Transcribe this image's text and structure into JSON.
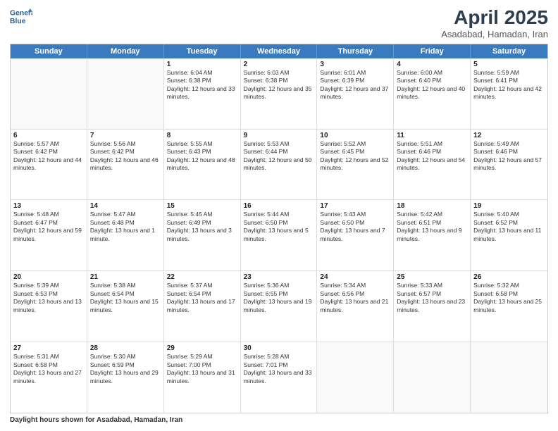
{
  "header": {
    "logo_line1": "General",
    "logo_line2": "Blue",
    "month": "April 2025",
    "location": "Asadabad, Hamadan, Iran"
  },
  "days_of_week": [
    "Sunday",
    "Monday",
    "Tuesday",
    "Wednesday",
    "Thursday",
    "Friday",
    "Saturday"
  ],
  "weeks": [
    [
      {
        "day": "",
        "empty": true
      },
      {
        "day": "",
        "empty": true
      },
      {
        "day": "1",
        "sunrise": "6:04 AM",
        "sunset": "6:38 PM",
        "daylight": "12 hours and 33 minutes."
      },
      {
        "day": "2",
        "sunrise": "6:03 AM",
        "sunset": "6:38 PM",
        "daylight": "12 hours and 35 minutes."
      },
      {
        "day": "3",
        "sunrise": "6:01 AM",
        "sunset": "6:39 PM",
        "daylight": "12 hours and 37 minutes."
      },
      {
        "day": "4",
        "sunrise": "6:00 AM",
        "sunset": "6:40 PM",
        "daylight": "12 hours and 40 minutes."
      },
      {
        "day": "5",
        "sunrise": "5:59 AM",
        "sunset": "6:41 PM",
        "daylight": "12 hours and 42 minutes."
      }
    ],
    [
      {
        "day": "6",
        "sunrise": "5:57 AM",
        "sunset": "6:42 PM",
        "daylight": "12 hours and 44 minutes."
      },
      {
        "day": "7",
        "sunrise": "5:56 AM",
        "sunset": "6:42 PM",
        "daylight": "12 hours and 46 minutes."
      },
      {
        "day": "8",
        "sunrise": "5:55 AM",
        "sunset": "6:43 PM",
        "daylight": "12 hours and 48 minutes."
      },
      {
        "day": "9",
        "sunrise": "5:53 AM",
        "sunset": "6:44 PM",
        "daylight": "12 hours and 50 minutes."
      },
      {
        "day": "10",
        "sunrise": "5:52 AM",
        "sunset": "6:45 PM",
        "daylight": "12 hours and 52 minutes."
      },
      {
        "day": "11",
        "sunrise": "5:51 AM",
        "sunset": "6:46 PM",
        "daylight": "12 hours and 54 minutes."
      },
      {
        "day": "12",
        "sunrise": "5:49 AM",
        "sunset": "6:46 PM",
        "daylight": "12 hours and 57 minutes."
      }
    ],
    [
      {
        "day": "13",
        "sunrise": "5:48 AM",
        "sunset": "6:47 PM",
        "daylight": "12 hours and 59 minutes."
      },
      {
        "day": "14",
        "sunrise": "5:47 AM",
        "sunset": "6:48 PM",
        "daylight": "13 hours and 1 minute."
      },
      {
        "day": "15",
        "sunrise": "5:45 AM",
        "sunset": "6:49 PM",
        "daylight": "13 hours and 3 minutes."
      },
      {
        "day": "16",
        "sunrise": "5:44 AM",
        "sunset": "6:50 PM",
        "daylight": "13 hours and 5 minutes."
      },
      {
        "day": "17",
        "sunrise": "5:43 AM",
        "sunset": "6:50 PM",
        "daylight": "13 hours and 7 minutes."
      },
      {
        "day": "18",
        "sunrise": "5:42 AM",
        "sunset": "6:51 PM",
        "daylight": "13 hours and 9 minutes."
      },
      {
        "day": "19",
        "sunrise": "5:40 AM",
        "sunset": "6:52 PM",
        "daylight": "13 hours and 11 minutes."
      }
    ],
    [
      {
        "day": "20",
        "sunrise": "5:39 AM",
        "sunset": "6:53 PM",
        "daylight": "13 hours and 13 minutes."
      },
      {
        "day": "21",
        "sunrise": "5:38 AM",
        "sunset": "6:54 PM",
        "daylight": "13 hours and 15 minutes."
      },
      {
        "day": "22",
        "sunrise": "5:37 AM",
        "sunset": "6:54 PM",
        "daylight": "13 hours and 17 minutes."
      },
      {
        "day": "23",
        "sunrise": "5:36 AM",
        "sunset": "6:55 PM",
        "daylight": "13 hours and 19 minutes."
      },
      {
        "day": "24",
        "sunrise": "5:34 AM",
        "sunset": "6:56 PM",
        "daylight": "13 hours and 21 minutes."
      },
      {
        "day": "25",
        "sunrise": "5:33 AM",
        "sunset": "6:57 PM",
        "daylight": "13 hours and 23 minutes."
      },
      {
        "day": "26",
        "sunrise": "5:32 AM",
        "sunset": "6:58 PM",
        "daylight": "13 hours and 25 minutes."
      }
    ],
    [
      {
        "day": "27",
        "sunrise": "5:31 AM",
        "sunset": "6:58 PM",
        "daylight": "13 hours and 27 minutes."
      },
      {
        "day": "28",
        "sunrise": "5:30 AM",
        "sunset": "6:59 PM",
        "daylight": "13 hours and 29 minutes."
      },
      {
        "day": "29",
        "sunrise": "5:29 AM",
        "sunset": "7:00 PM",
        "daylight": "13 hours and 31 minutes."
      },
      {
        "day": "30",
        "sunrise": "5:28 AM",
        "sunset": "7:01 PM",
        "daylight": "13 hours and 33 minutes."
      },
      {
        "day": "",
        "empty": true
      },
      {
        "day": "",
        "empty": true
      },
      {
        "day": "",
        "empty": true
      }
    ]
  ],
  "footer": {
    "label": "Daylight hours",
    "description": "shown for Asadabad, Hamadan, Iran"
  }
}
